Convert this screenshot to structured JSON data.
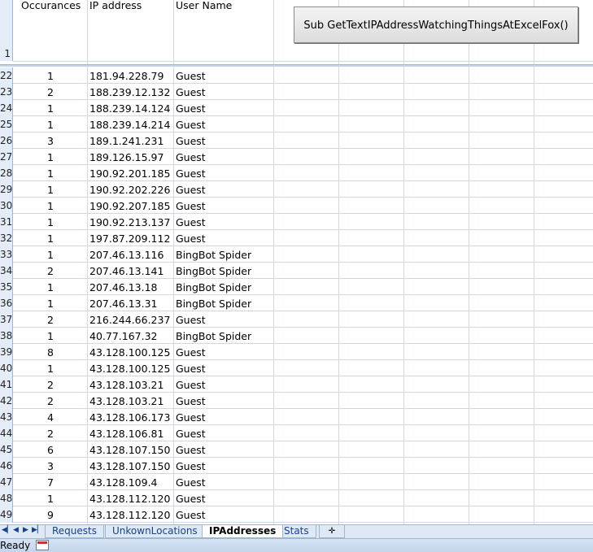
{
  "header": {
    "row_number": "1",
    "col_a": "Occurances",
    "col_b": "IP address",
    "col_c": "User Name"
  },
  "macro_button_label": "Sub GetTextIPAddressWatchingThingsAtExcelFox()",
  "rows": [
    {
      "n": "22",
      "occ": "1",
      "ip": "181.94.228.79",
      "user": "Guest"
    },
    {
      "n": "23",
      "occ": "2",
      "ip": "188.239.12.132",
      "user": "Guest"
    },
    {
      "n": "24",
      "occ": "1",
      "ip": "188.239.14.124",
      "user": "Guest"
    },
    {
      "n": "25",
      "occ": "1",
      "ip": "188.239.14.214",
      "user": "Guest"
    },
    {
      "n": "26",
      "occ": "3",
      "ip": "189.1.241.231",
      "user": "Guest"
    },
    {
      "n": "27",
      "occ": "1",
      "ip": "189.126.15.97",
      "user": "Guest"
    },
    {
      "n": "28",
      "occ": "1",
      "ip": "190.92.201.185",
      "user": "Guest"
    },
    {
      "n": "29",
      "occ": "1",
      "ip": "190.92.202.226",
      "user": "Guest"
    },
    {
      "n": "30",
      "occ": "1",
      "ip": "190.92.207.185",
      "user": "Guest"
    },
    {
      "n": "31",
      "occ": "1",
      "ip": "190.92.213.137",
      "user": "Guest"
    },
    {
      "n": "32",
      "occ": "1",
      "ip": "197.87.209.112",
      "user": "Guest"
    },
    {
      "n": "33",
      "occ": "1",
      "ip": "207.46.13.116",
      "user": "BingBot Spider"
    },
    {
      "n": "34",
      "occ": "2",
      "ip": "207.46.13.141",
      "user": "BingBot Spider"
    },
    {
      "n": "35",
      "occ": "1",
      "ip": "207.46.13.18",
      "user": "BingBot Spider"
    },
    {
      "n": "36",
      "occ": "1",
      "ip": "207.46.13.31",
      "user": "BingBot Spider"
    },
    {
      "n": "37",
      "occ": "2",
      "ip": "216.244.66.237",
      "user": "Guest"
    },
    {
      "n": "38",
      "occ": "1",
      "ip": "40.77.167.32",
      "user": "BingBot Spider"
    },
    {
      "n": "39",
      "occ": "8",
      "ip": "43.128.100.125",
      "user": "Guest"
    },
    {
      "n": "40",
      "occ": "1",
      "ip": "43.128.100.125",
      "user": "Guest"
    },
    {
      "n": "41",
      "occ": "2",
      "ip": "43.128.103.21",
      "user": "Guest"
    },
    {
      "n": "42",
      "occ": "2",
      "ip": "43.128.103.21",
      "user": "Guest"
    },
    {
      "n": "43",
      "occ": "4",
      "ip": "43.128.106.173",
      "user": "Guest"
    },
    {
      "n": "44",
      "occ": "2",
      "ip": "43.128.106.81",
      "user": "Guest"
    },
    {
      "n": "45",
      "occ": "6",
      "ip": "43.128.107.150",
      "user": "Guest"
    },
    {
      "n": "46",
      "occ": "3",
      "ip": "43.128.107.150",
      "user": "Guest"
    },
    {
      "n": "47",
      "occ": "7",
      "ip": "43.128.109.4",
      "user": "Guest"
    },
    {
      "n": "48",
      "occ": "1",
      "ip": "43.128.112.120",
      "user": "Guest"
    },
    {
      "n": "49",
      "occ": "9",
      "ip": "43.128.112.120",
      "user": "Guest"
    }
  ],
  "sheet_tabs": [
    {
      "label": "Requests",
      "active": false
    },
    {
      "label": "UnkownLocations",
      "active": false
    },
    {
      "label": "IPAddresses",
      "active": true
    },
    {
      "label": "Stats",
      "active": false
    }
  ],
  "status": {
    "text": "Ready"
  },
  "colors": {
    "grid_line": "#d0d7e5",
    "row_header_bg": "#e4ecf7",
    "tab_bar_bg": "#dfe8f5",
    "accent": "#15428b"
  },
  "icons": [
    "first-sheet-icon",
    "prev-sheet-icon",
    "next-sheet-icon",
    "last-sheet-icon",
    "insert-sheet-icon",
    "macro-record-icon"
  ]
}
